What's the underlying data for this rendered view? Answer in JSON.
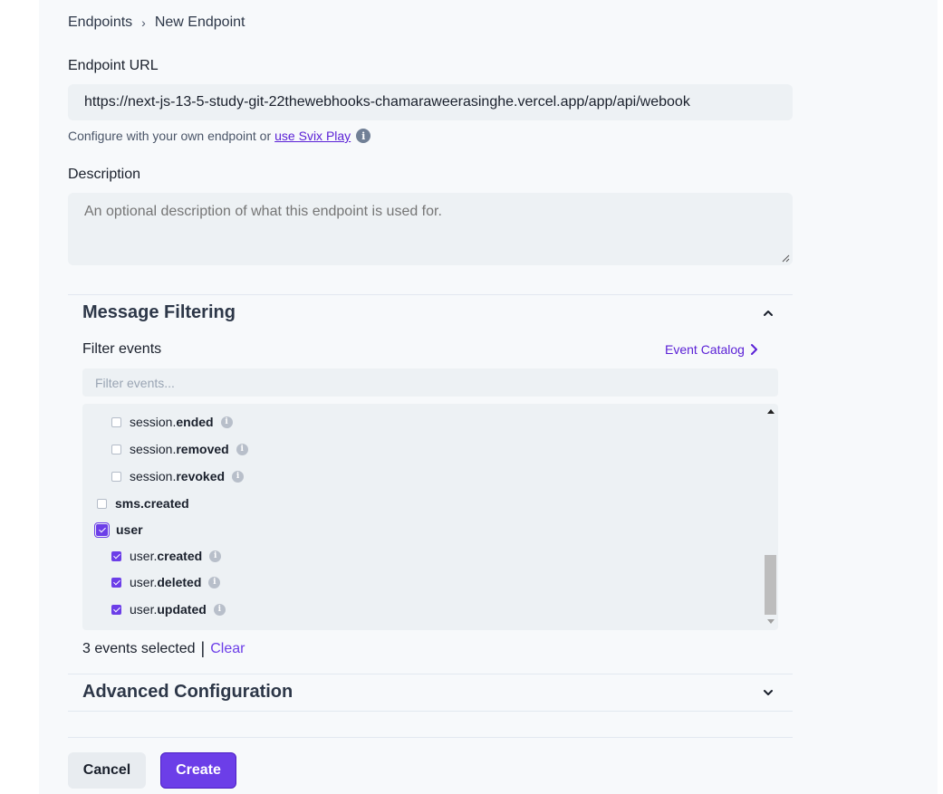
{
  "breadcrumb": {
    "parent": "Endpoints",
    "separator": "›",
    "current": "New Endpoint"
  },
  "endpoint_url": {
    "label": "Endpoint URL",
    "value": "https://next-js-13-5-study-git-22thewebhooks-chamaraweerasinghe.vercel.app/app/api/webook",
    "helper_text": "Configure with your own endpoint or",
    "helper_link": "use Svix Play",
    "info_glyph": "i"
  },
  "description": {
    "label": "Description",
    "placeholder": "An optional description of what this endpoint is used for."
  },
  "message_filtering": {
    "title": "Message Filtering",
    "expanded": true,
    "filter_label": "Filter events",
    "catalog_link": "Event Catalog",
    "filter_placeholder": "Filter events...",
    "events": [
      {
        "prefix": "session.",
        "suffix": "ended",
        "checked": false,
        "level": "child",
        "info": "i"
      },
      {
        "prefix": "session.",
        "suffix": "removed",
        "checked": false,
        "level": "child",
        "info": "i"
      },
      {
        "prefix": "session.",
        "suffix": "revoked",
        "checked": false,
        "level": "child",
        "info": "i"
      },
      {
        "prefix": "",
        "suffix": "sms.created",
        "checked": false,
        "level": "group",
        "info": ""
      },
      {
        "prefix": "",
        "suffix": "user",
        "checked": true,
        "level": "group",
        "info": ""
      },
      {
        "prefix": "user.",
        "suffix": "created",
        "checked": true,
        "level": "child",
        "info": "i"
      },
      {
        "prefix": "user.",
        "suffix": "deleted",
        "checked": true,
        "level": "child",
        "info": "i"
      },
      {
        "prefix": "user.",
        "suffix": "updated",
        "checked": true,
        "level": "child",
        "info": "i"
      }
    ],
    "selected_count_text": "3 events selected",
    "divider": "|",
    "clear_label": "Clear"
  },
  "advanced": {
    "title": "Advanced Configuration",
    "expanded": false
  },
  "actions": {
    "cancel_label": "Cancel",
    "create_label": "Create"
  },
  "colors": {
    "accent": "#6c3ee8",
    "link": "#5b21d6",
    "field_bg": "#edf1f4"
  }
}
